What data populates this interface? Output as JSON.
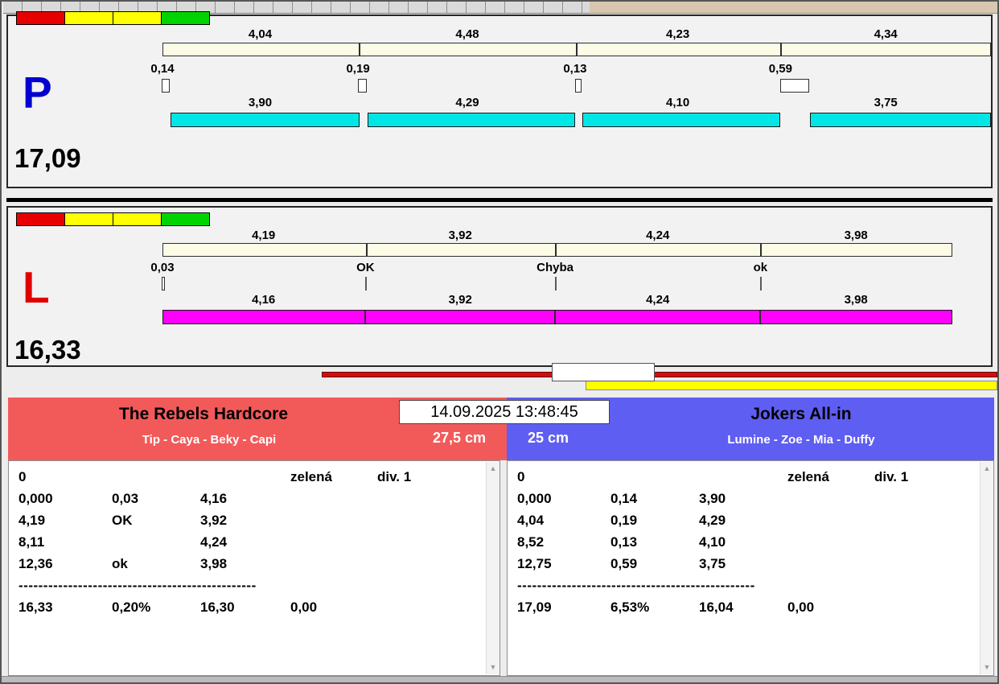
{
  "window": {
    "datetime": "14.09.2025 13:48:45"
  },
  "panels": [
    {
      "letter": "P",
      "letter_color": "#0000d0",
      "total": "17,09",
      "status_colors": [
        "#e80000",
        "#ffff00",
        "#ffff00",
        "#00d400"
      ],
      "split_labels": [
        "4,04",
        "4,48",
        "4,23",
        "4,34"
      ],
      "change_labels": [
        "0,14",
        "0,19",
        "0,13",
        "0,59"
      ],
      "run_labels": [
        "3,90",
        "4,29",
        "4,10",
        "3,75"
      ],
      "split_bar_color": "#fcfce6",
      "run_bar_color": "#00e6e6"
    },
    {
      "letter": "L",
      "letter_color": "#e00000",
      "total": "16,33",
      "status_colors": [
        "#e80000",
        "#ffff00",
        "#ffff00",
        "#00d400"
      ],
      "split_labels": [
        "4,19",
        "3,92",
        "4,24",
        "3,98"
      ],
      "change_labels": [
        "0,03",
        "OK",
        "Chyba",
        "ok"
      ],
      "run_labels": [
        "4,16",
        "3,92",
        "4,24",
        "3,98"
      ],
      "split_bar_color": "#fcfce6",
      "run_bar_color": "#ff00ff"
    }
  ],
  "teams": {
    "left": {
      "name": "The Rebels Hardcore",
      "members": "Tip - Caya - Beky - Capi",
      "jump_height": "27,5 cm",
      "header_color": "#f25a5a",
      "separator": "------------------------------------------------",
      "rows": [
        {
          "c0": "0",
          "c3": "zelená",
          "c4": "div. 1"
        },
        {
          "c0": "0,000",
          "c1": "0,03",
          "c2": "4,16"
        },
        {
          "c0": "4,19",
          "c1": "OK",
          "c2": "3,92"
        },
        {
          "c0": "8,11",
          "c2": "4,24"
        },
        {
          "c0": "12,36",
          "c1": "ok",
          "c2": "3,98"
        },
        {
          "c0": "16,33",
          "c1": "0,20%",
          "c2": "16,30",
          "c3": "0,00"
        }
      ]
    },
    "right": {
      "name": "Jokers All-in",
      "members": "Lumine - Zoe - Mia - Duffy",
      "jump_height": "25 cm",
      "header_color": "#5e5ef2",
      "separator": "------------------------------------------------",
      "rows": [
        {
          "c0": "0",
          "c3": "zelená",
          "c4": "div. 1"
        },
        {
          "c0": "0,000",
          "c1": "0,14",
          "c2": "3,90"
        },
        {
          "c0": "4,04",
          "c1": "0,19",
          "c2": "4,29"
        },
        {
          "c0": "8,52",
          "c1": "0,13",
          "c2": "4,10"
        },
        {
          "c0": "12,75",
          "c1": "0,59",
          "c2": "3,75"
        },
        {
          "c0": "17,09",
          "c1": "6,53%",
          "c2": "16,04",
          "c3": "0,00"
        }
      ]
    },
    "scroll_up_glyph": "▲",
    "scroll_down_glyph": "▼"
  }
}
